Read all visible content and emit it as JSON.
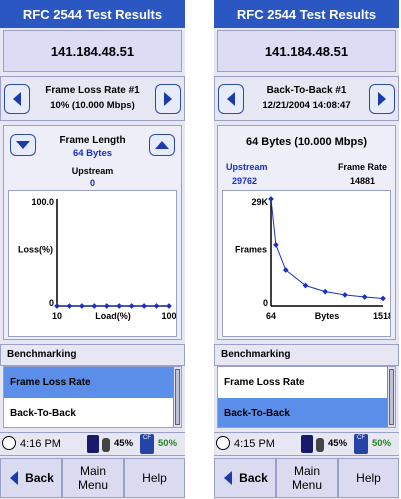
{
  "screens": [
    {
      "title": "RFC 2544 Test Results",
      "ip": "141.184.48.51",
      "nav": {
        "line1": "Frame Loss Rate #1",
        "line2": "10% (10.000 Mbps)"
      },
      "graph": {
        "header_label": "Frame Length",
        "header_value": "64 Bytes",
        "sub_label": "Upstream",
        "sub_value": "0"
      },
      "benchmarking": {
        "header": "Benchmarking",
        "items": [
          "Frame Loss Rate",
          "Back-To-Back"
        ],
        "selected_index": 0
      },
      "status": {
        "time": "4:16 PM",
        "battery": "45%",
        "card": "50%"
      },
      "buttons": {
        "back": "Back",
        "main_line1": "Main",
        "main_line2": "Menu",
        "help": "Help"
      },
      "chart_data": {
        "type": "line",
        "ylabel": "Loss(%)",
        "xlabel": "Load(%)",
        "y_tick_top": "100.0",
        "y_tick_bottom": "0",
        "x_tick_left": "10",
        "x_tick_right": "100",
        "ylim": [
          0,
          100
        ],
        "xlim": [
          10,
          100
        ],
        "x": [
          10,
          20,
          30,
          40,
          50,
          60,
          70,
          80,
          90,
          100
        ],
        "values": [
          0,
          0,
          0,
          0,
          0,
          0,
          0,
          0,
          0,
          0
        ]
      }
    },
    {
      "title": "RFC 2544 Test Results",
      "ip": "141.184.48.51",
      "nav": {
        "line1": "Back-To-Back #1",
        "line2": "12/21/2004 14:08:47"
      },
      "graph": {
        "header_label": "64 Bytes (10.000 Mbps)",
        "upstream_label": "Upstream",
        "upstream_value": "29762",
        "frame_rate_label": "Frame Rate",
        "frame_rate_value": "14881"
      },
      "benchmarking": {
        "header": "Benchmarking",
        "items": [
          "Frame Loss Rate",
          "Back-To-Back"
        ],
        "selected_index": 1
      },
      "status": {
        "time": "4:15 PM",
        "battery": "45%",
        "card": "50%"
      },
      "buttons": {
        "back": "Back",
        "main_line1": "Main",
        "main_line2": "Menu",
        "help": "Help"
      },
      "chart_data": {
        "type": "line",
        "ylabel": "Frames",
        "xlabel": "Bytes",
        "y_tick_top": "29K",
        "y_tick_bottom": "0",
        "x_tick_left": "64",
        "x_tick_right": "1518",
        "ylim": [
          0,
          29762
        ],
        "xlim": [
          64,
          1518
        ],
        "x": [
          64,
          128,
          256,
          512,
          768,
          1024,
          1280,
          1518
        ],
        "values": [
          29762,
          17000,
          10000,
          5700,
          4000,
          3100,
          2500,
          2100
        ]
      }
    }
  ],
  "colors": {
    "title_bar": "#2a57c2",
    "selected": "#5a8ee8",
    "line": "#1830c8",
    "accent_value": "#1830c8",
    "card_pct": "#1a8a1a"
  },
  "icons": {
    "nav_left": "left-arrow-icon",
    "nav_right": "right-arrow-icon",
    "down": "chevron-down-icon",
    "up": "chevron-up-icon",
    "clock": "clock-icon",
    "battery": "battery-icon",
    "card": "cf-card-icon"
  }
}
